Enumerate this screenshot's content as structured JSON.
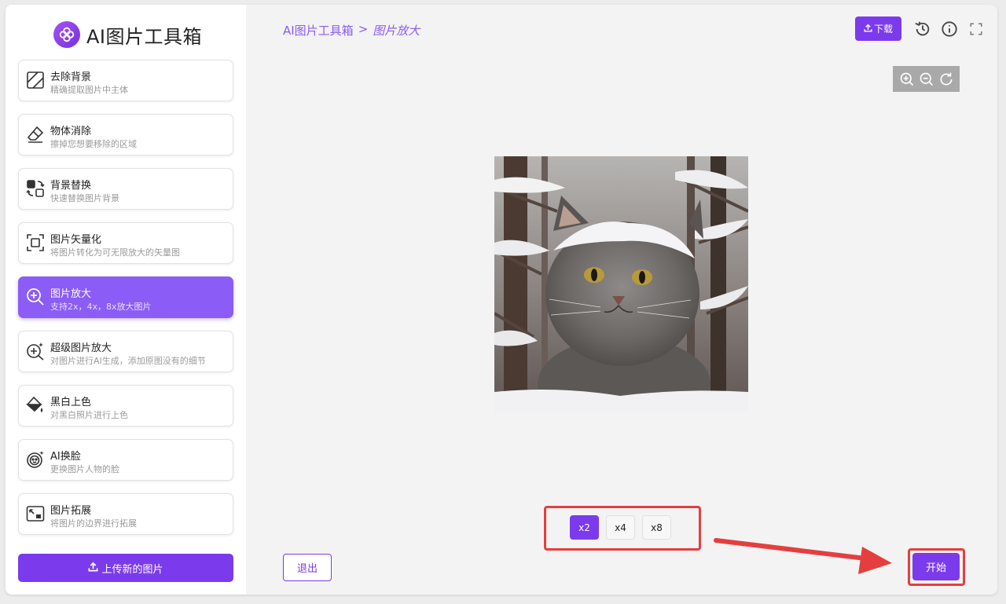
{
  "app": {
    "title": "AI图片工具箱"
  },
  "sidebar": {
    "tools": [
      {
        "label": "去除背景",
        "desc": "精确提取图片中主体",
        "icon": "remove-background-icon"
      },
      {
        "label": "物体消除",
        "desc": "擦掉您想要移除的区域",
        "icon": "eraser-icon"
      },
      {
        "label": "背景替换",
        "desc": "快速替换图片背景",
        "icon": "swap-icon"
      },
      {
        "label": "图片矢量化",
        "desc": "将图片转化为可无限放大的矢量图",
        "icon": "vector-frame-icon"
      },
      {
        "label": "图片放大",
        "desc": "支持2x，4x，8x放大图片",
        "icon": "zoom-in-icon",
        "active": true
      },
      {
        "label": "超级图片放大",
        "desc": "对图片进行AI生成，添加原图没有的细节",
        "icon": "sparkle-zoom-icon"
      },
      {
        "label": "黑白上色",
        "desc": "对黑白照片进行上色",
        "icon": "paint-bucket-icon"
      },
      {
        "label": "AI换脸",
        "desc": "更换图片人物的脸",
        "icon": "face-icon"
      },
      {
        "label": "图片拓展",
        "desc": "将图片的边界进行拓展",
        "icon": "expand-image-icon"
      }
    ],
    "upload_label": "上传新的图片"
  },
  "breadcrumb": {
    "root": "AI图片工具箱",
    "separator": ">",
    "current": "图片放大"
  },
  "toolbar": {
    "download_label": "下载"
  },
  "scale_options": [
    "x2",
    "x4",
    "x8"
  ],
  "selected_scale": "x2",
  "actions": {
    "exit_label": "退出",
    "start_label": "开始"
  },
  "colors": {
    "accent": "#7c3aed",
    "active_item": "#8b5cf6",
    "highlight": "#e53e3e"
  }
}
